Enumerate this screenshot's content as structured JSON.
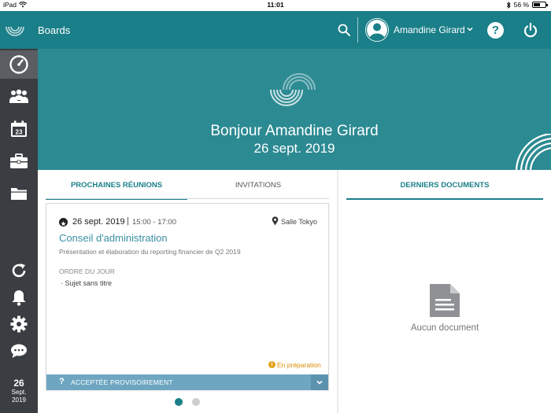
{
  "status_bar": {
    "device": "iPad",
    "time": "11:01",
    "battery_text": "56 %",
    "battery_level": 0.56
  },
  "header": {
    "app_title": "Boards",
    "user_name": "Amandine Girard",
    "help_label": "?"
  },
  "sidebar": {
    "items": [
      {
        "icon": "dashboard-icon",
        "active": true
      },
      {
        "icon": "people-icon"
      },
      {
        "icon": "calendar-icon",
        "day": "23"
      },
      {
        "icon": "briefcase-icon"
      },
      {
        "icon": "folder-icon"
      },
      {
        "icon": "sync-icon"
      },
      {
        "icon": "bell-icon"
      },
      {
        "icon": "gear-icon"
      },
      {
        "icon": "chat-icon"
      }
    ],
    "date": {
      "day": "26",
      "month": "Sept.",
      "year": "2019"
    }
  },
  "banner": {
    "greeting": "Bonjour Amandine Girard",
    "date": "26 sept. 2019"
  },
  "meetings_panel": {
    "tabs": [
      {
        "label": "PROCHAINES RÉUNIONS",
        "active": true
      },
      {
        "label": "INVITATIONS",
        "active": false
      }
    ],
    "meeting": {
      "date": "26 sept. 2019",
      "separator": "|",
      "time": "15:00 - 17:00",
      "room": "Salle Tokyo",
      "title": "Conseil d'administration",
      "description": "Présentation et élaboration du reporting financier de Q2 2019",
      "agenda_heading": "ORDRE DU JOUR",
      "agenda_items": [
        "Sujet sans titre"
      ],
      "status": "En préparation",
      "acceptance_icon": "?",
      "acceptance": "ACCEPTÉE PROVISOIREMENT"
    },
    "pagination": {
      "pages": 2,
      "current": 1
    }
  },
  "documents_panel": {
    "tab_label": "DERNIERS DOCUMENTS",
    "empty_text": "Aucun document"
  },
  "colors": {
    "header": "#1a7f88",
    "banner": "#2c8a92",
    "sidebar": "#3a3d42",
    "link": "#3a8fa3",
    "acceptance_bar": "#6ea6c1",
    "status_warning": "#e3a21a"
  }
}
